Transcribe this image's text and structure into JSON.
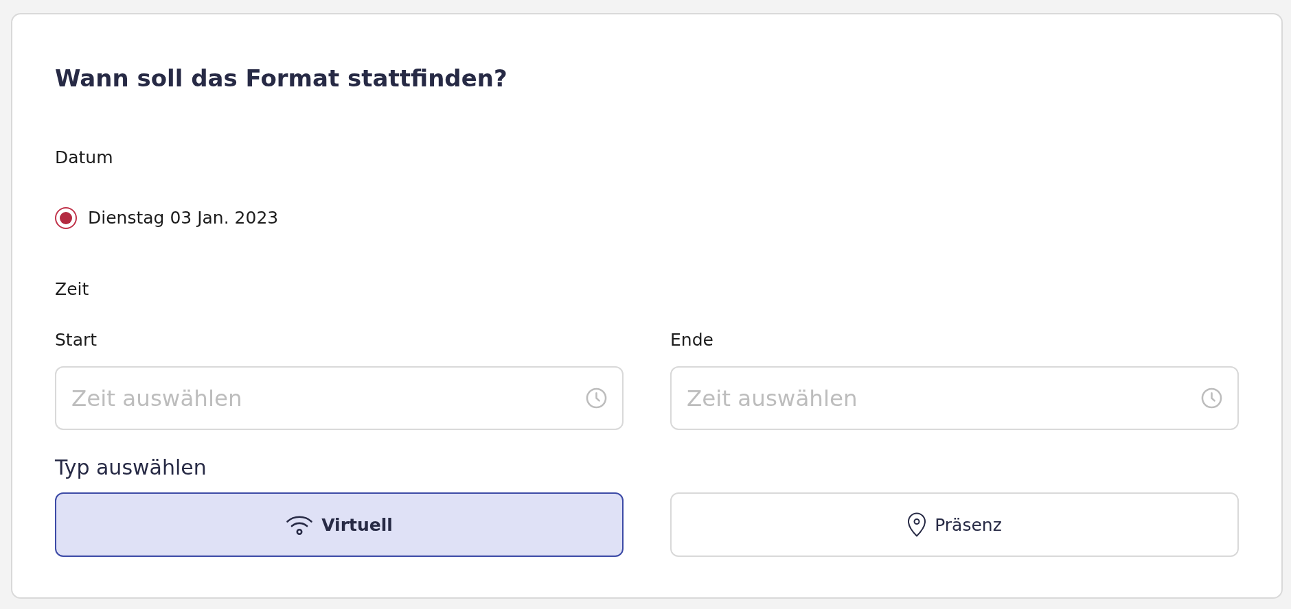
{
  "heading": "Wann soll das Format stattfinden?",
  "date": {
    "label": "Datum",
    "options": [
      {
        "label": "Dienstag 03 Jan. 2023",
        "selected": true
      }
    ]
  },
  "time": {
    "label": "Zeit",
    "fields": [
      {
        "label": "Start",
        "placeholder": "Zeit auswählen"
      },
      {
        "label": "Ende",
        "placeholder": "Zeit auswählen"
      }
    ]
  },
  "type": {
    "label": "Typ auswählen",
    "options": [
      {
        "label": "Virtuell",
        "kind": "virtual",
        "selected": true
      },
      {
        "label": "Präsenz",
        "kind": "in_person",
        "selected": false
      }
    ]
  }
}
